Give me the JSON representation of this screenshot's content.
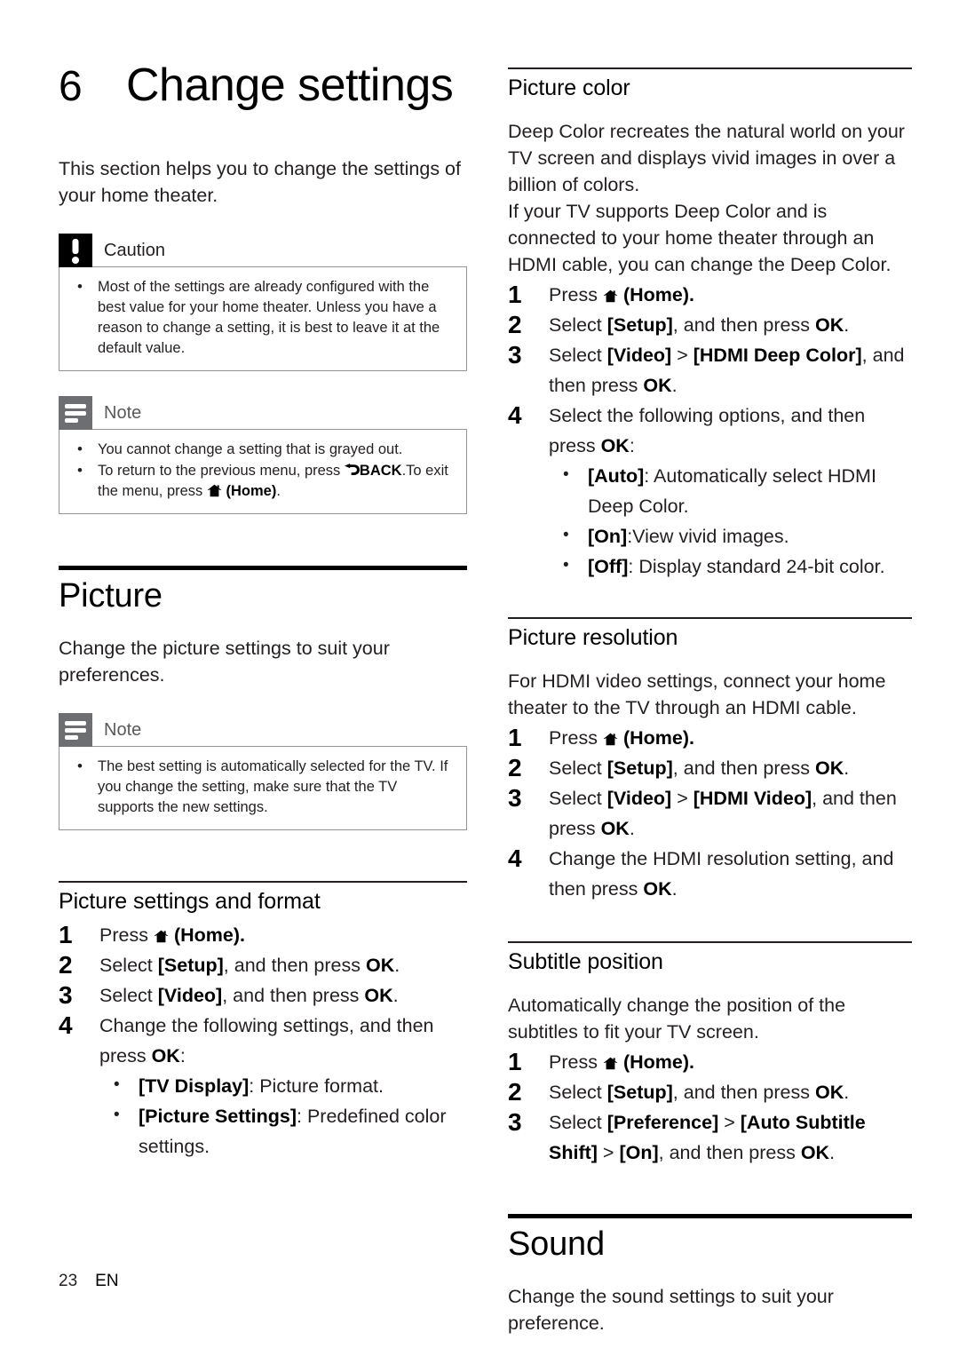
{
  "document": {
    "chapter_number": "6",
    "chapter_title": "Change settings",
    "intro": "This section helps you to change the settings of your home theater.",
    "footer_page": "23",
    "footer_lang": "EN"
  },
  "icons": {
    "home": "home-icon",
    "back": "back-icon",
    "caution": "caution-icon",
    "note": "note-icon"
  },
  "colors": {
    "caution_badge": "#000000",
    "note_badge": "#6d6e71",
    "rule_thick": "#000000",
    "rule_thin": "#231f20",
    "text": "#231f20"
  },
  "caution": {
    "label": "Caution",
    "items": [
      "Most of the settings are already configured with the best value for your home theater. Unless you have a reason to change a setting, it is best to leave it at the default value."
    ]
  },
  "note_top": {
    "label": "Note",
    "item1": "You cannot change a setting that is grayed out.",
    "item2_a": "To return to the previous menu, press",
    "item2_back": "BACK",
    "item2_b": ".To exit the menu, press",
    "item2_home": "(Home)",
    "item2_c": "."
  },
  "picture_section": {
    "heading": "Picture",
    "intro": "Change the picture settings to suit your preferences.",
    "note": {
      "label": "Note",
      "items": [
        "The best setting is automatically selected for the TV. If you change the setting, make sure that the TV supports the new settings."
      ]
    }
  },
  "picture_settings_format": {
    "heading": "Picture settings and format",
    "step1_a": "Press",
    "step1_b": "(Home).",
    "step2_a": "Select",
    "step2_bold": "[Setup]",
    "step2_b": ", and then press",
    "step2_ok": "OK",
    "step2_c": ".",
    "step3_a": "Select",
    "step3_bold": "[Video]",
    "step3_b": ", and then press",
    "step3_ok": "OK",
    "step3_c": ".",
    "step4_a": "Change the following settings, and then press",
    "step4_ok": "OK",
    "step4_c": ":",
    "bullet1_bold": "[TV Display]",
    "bullet1_rest": ": Picture format.",
    "bullet2_bold": "[Picture Settings]",
    "bullet2_rest": ": Predefined color settings."
  },
  "picture_color": {
    "heading": "Picture color",
    "para1": "Deep Color recreates the natural world on your TV screen and displays vivid images in over a billion of colors.",
    "para2": "If your TV supports Deep Color and is connected to your home theater through an HDMI cable, you can change the Deep Color.",
    "step1_a": "Press",
    "step1_b": "(Home).",
    "step2_a": "Select",
    "step2_bold": "[Setup]",
    "step2_b": ", and then press",
    "step2_ok": "OK",
    "step2_c": ".",
    "step3_a": "Select",
    "step3_bold1": "[Video]",
    "step3_gt": ">",
    "step3_bold2": "[HDMI Deep Color]",
    "step3_b": ", and then press",
    "step3_ok": "OK",
    "step3_c": ".",
    "step4_a": "Select the following options, and then press",
    "step4_ok": "OK",
    "step4_c": ":",
    "bullet1_bold": "[Auto]",
    "bullet1_rest": ": Automatically select HDMI Deep Color.",
    "bullet2_bold": "[On]",
    "bullet2_rest": ":View vivid images.",
    "bullet3_bold": "[Off]",
    "bullet3_rest": ": Display standard 24-bit color."
  },
  "picture_resolution": {
    "heading": "Picture resolution",
    "intro": "For HDMI video settings, connect your home theater to the TV through an HDMI cable.",
    "step1_a": "Press",
    "step1_b": "(Home).",
    "step2_a": "Select",
    "step2_bold": "[Setup]",
    "step2_b": ", and then press",
    "step2_ok": "OK",
    "step2_c": ".",
    "step3_a": "Select",
    "step3_bold1": "[Video]",
    "step3_gt": ">",
    "step3_bold2": "[HDMI Video]",
    "step3_b": ", and then press",
    "step3_ok": "OK",
    "step3_c": ".",
    "step4_a": "Change the HDMI resolution setting, and then press",
    "step4_ok": "OK",
    "step4_c": "."
  },
  "subtitle_position": {
    "heading": "Subtitle position",
    "intro": "Automatically change the position of the subtitles to fit your TV screen.",
    "step1_a": "Press",
    "step1_b": "(Home).",
    "step2_a": "Select",
    "step2_bold": "[Setup]",
    "step2_b": ", and then press",
    "step2_ok": "OK",
    "step2_c": ".",
    "step3_a": "Select",
    "step3_bold1": "[Preference]",
    "step3_gt": ">",
    "step3_bold2": "[Auto Subtitle Shift]",
    "step3_gt2": ">",
    "step3_bold3": "[On]",
    "step3_b": ", and then press",
    "step3_ok": "OK",
    "step3_c": "."
  },
  "sound_section": {
    "heading": "Sound",
    "intro": "Change the sound settings to suit your preference."
  }
}
